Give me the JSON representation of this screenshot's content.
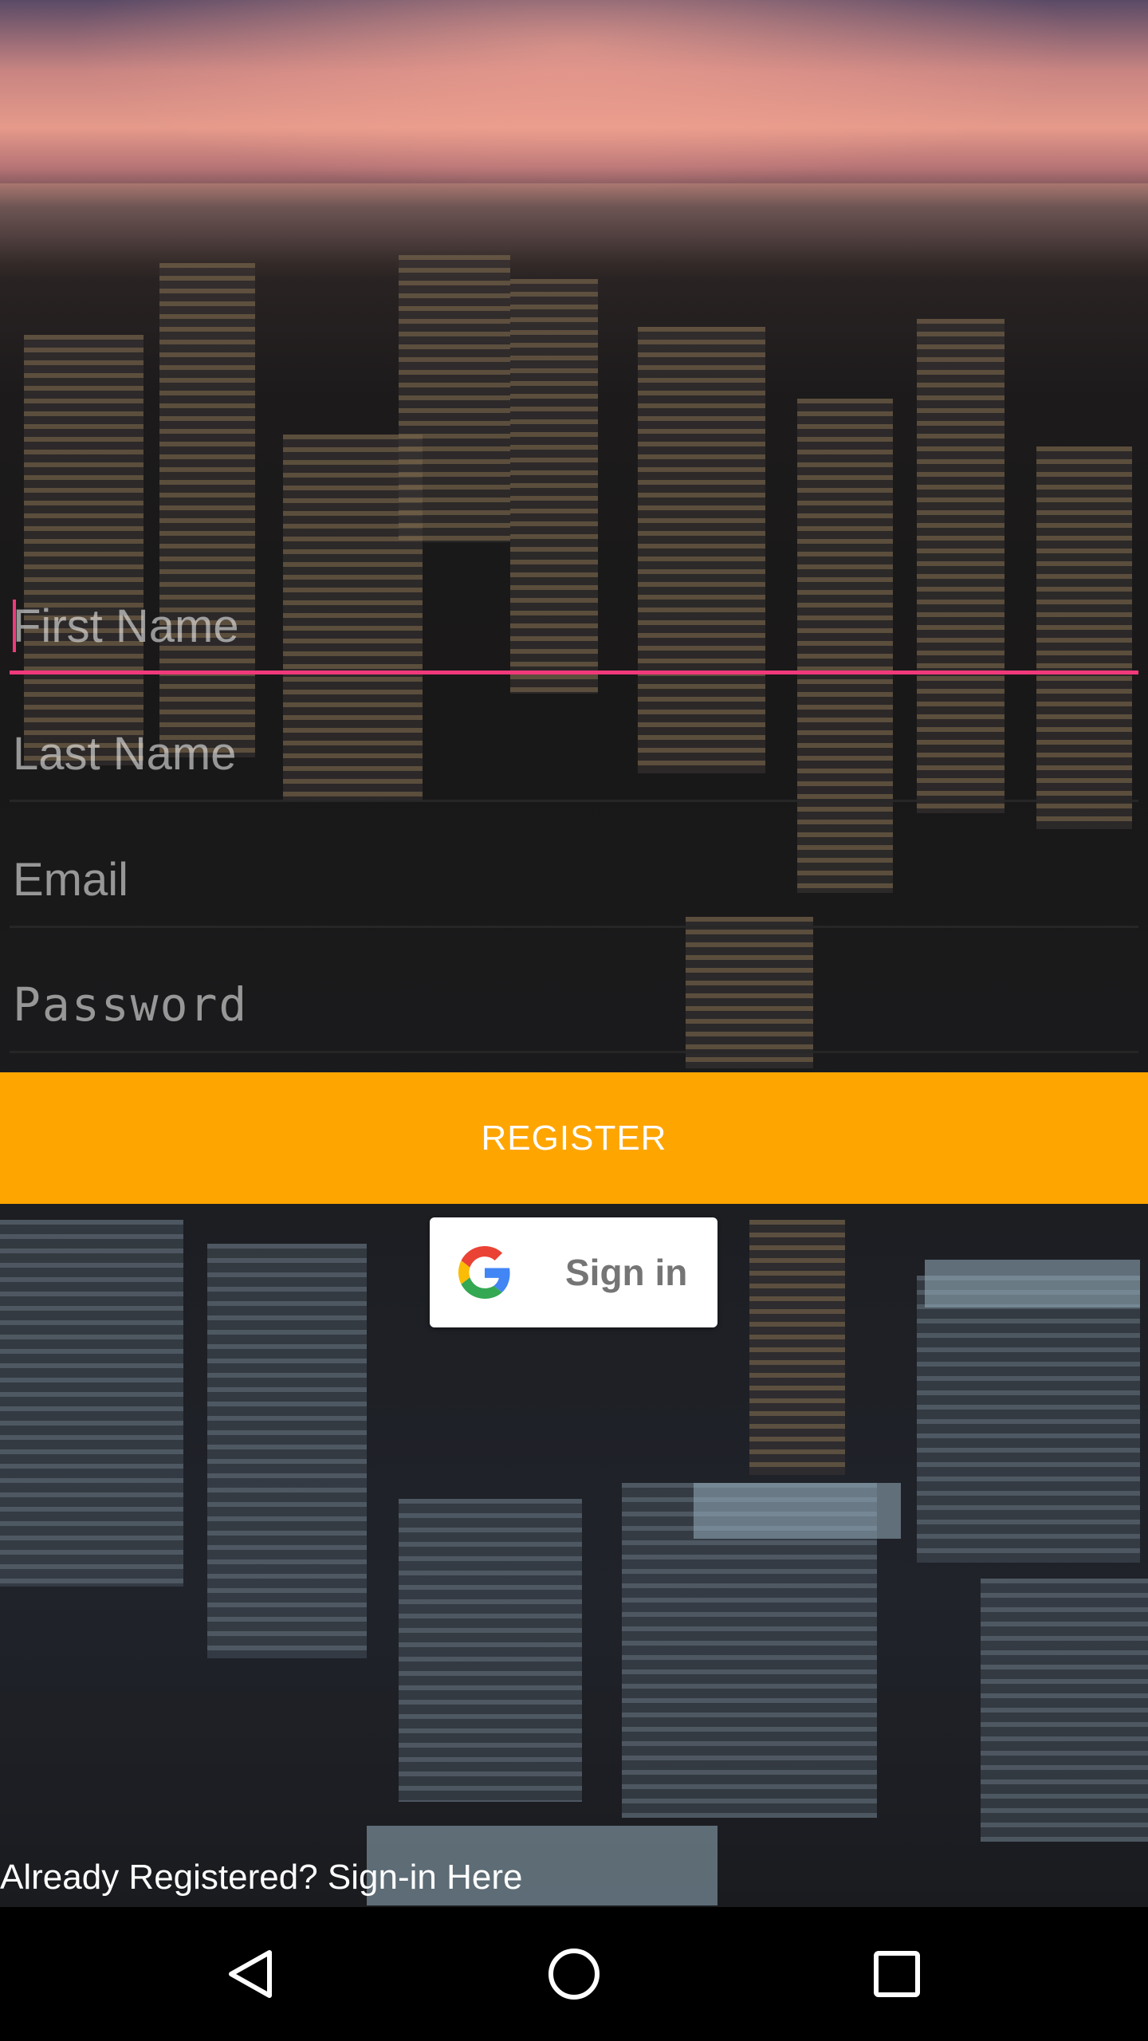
{
  "form": {
    "first_name": {
      "value": "",
      "placeholder": "First Name"
    },
    "last_name": {
      "value": "",
      "placeholder": "Last Name"
    },
    "email": {
      "value": "",
      "placeholder": "Email"
    },
    "password": {
      "value": "",
      "placeholder": "Password"
    }
  },
  "actions": {
    "register_label": "REGISTER",
    "google_signin_label": "Sign in",
    "already_registered_label": "Already Registered? Sign-in Here"
  },
  "colors": {
    "accent": "#f0397a",
    "register_bg": "#ffa500",
    "google_text": "#757575"
  },
  "icons": {
    "google": "google-g-icon",
    "back": "back-triangle-icon",
    "home": "home-circle-icon",
    "recents": "recents-square-icon"
  }
}
